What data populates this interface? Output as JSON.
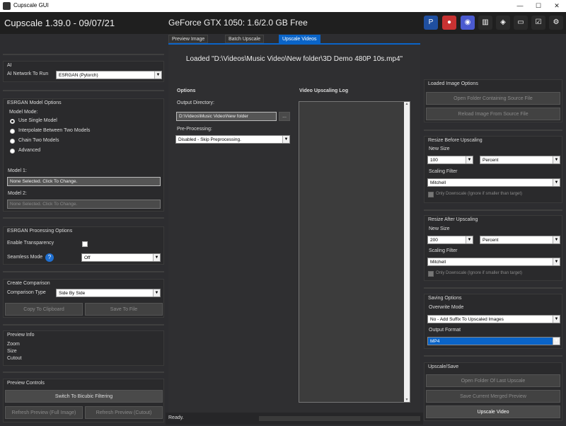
{
  "window": {
    "title": "Cupscale GUI",
    "min": "—",
    "max": "☐",
    "close": "✕"
  },
  "header": {
    "app_title": "Cupscale 1.39.0 - 09/07/21",
    "gpu_info": "GeForce GTX 1050: 1.6/2.0 GB Free",
    "icons": [
      "paypal-icon",
      "patreon-icon",
      "discord-icon",
      "models-icon",
      "layers-icon",
      "folder-icon",
      "checklist-icon",
      "gear-icon"
    ]
  },
  "tabs": [
    "Preview Image",
    "Batch Upscale",
    "Upscale Videos"
  ],
  "main": {
    "loaded_text": "Loaded \"D:\\Videos\\Music Video\\New folder\\3D Demo 480P 10s.mp4\"",
    "options_title": "Options",
    "output_dir_label": "Output Directory:",
    "output_dir_value": "D:\\Videos\\Music Video\\New folder",
    "browse_label": "...",
    "preproc_label": "Pre-Processing:",
    "preproc_value": "Disabled - Skip Preprocessing.",
    "log_title": "Video Upscaling Log",
    "status": "Ready."
  },
  "ai": {
    "title": "AI",
    "network_label": "AI Network To Run",
    "network_value": "ESRGAN (Pytorch)"
  },
  "model_options": {
    "title": "ESRGAN Model Options",
    "mode_label": "Model Mode:",
    "modes": [
      "Use Single Model",
      "Interpolate Between Two Models",
      "Chain Two Models",
      "Advanced"
    ],
    "model1_label": "Model 1:",
    "model1_value": "None Selected. Click To Change.",
    "model2_label": "Model 2:",
    "model2_value": "None Selected. Click To Change."
  },
  "processing": {
    "title": "ESRGAN Processing Options",
    "transparency_label": "Enable Transparency",
    "seamless_label": "Seamless Mode",
    "help": "?",
    "seamless_value": "Off"
  },
  "comparison": {
    "title": "Create Comparison",
    "type_label": "Comparison Type",
    "type_value": "Side By Side",
    "copy_label": "Copy To Clipboard",
    "save_label": "Save To File"
  },
  "preview_info": {
    "title": "Preview Info",
    "zoom": "Zoom",
    "size": "Size",
    "cutout": "Cutout"
  },
  "preview_controls": {
    "title": "Preview Controls",
    "bicubic": "Switch To Bicubic Filtering",
    "refresh_full": "Refresh Preview (Full Image)",
    "refresh_cutout": "Refresh Preview (Cutout)"
  },
  "loaded_image": {
    "title": "Loaded Image Options",
    "open_folder": "Open Folder Containing Source File",
    "reload": "Reload Image From Source File"
  },
  "resize_before": {
    "title": "Resize Before Upscaling",
    "size_label": "New Size",
    "size_value": "100",
    "unit_value": "Percent",
    "filter_label": "Scaling Filter",
    "filter_value": "Mitchell",
    "only_down": "Only Downscale (Ignore if smaller than target)"
  },
  "resize_after": {
    "title": "Resize After Upscaling",
    "size_label": "New Size",
    "size_value": "200",
    "unit_value": "Percent",
    "filter_label": "Scaling Filter",
    "filter_value": "Mitchell",
    "only_down": "Only Downscale (Ignore if smaller than target)"
  },
  "saving": {
    "title": "Saving Options",
    "overwrite_label": "Overwrite Mode",
    "overwrite_value": "No - Add Suffix To Upscaled Images",
    "format_label": "Output Format",
    "format_value": "MP4"
  },
  "upscale_save": {
    "title": "Upscale/Save",
    "open_last": "Open Folder Of Last Upscale",
    "save_merged": "Save Current Merged Preview",
    "upscale_video": "Upscale Video"
  },
  "colors": {
    "bg": "#2d2d30",
    "accent": "#0a64c8"
  }
}
